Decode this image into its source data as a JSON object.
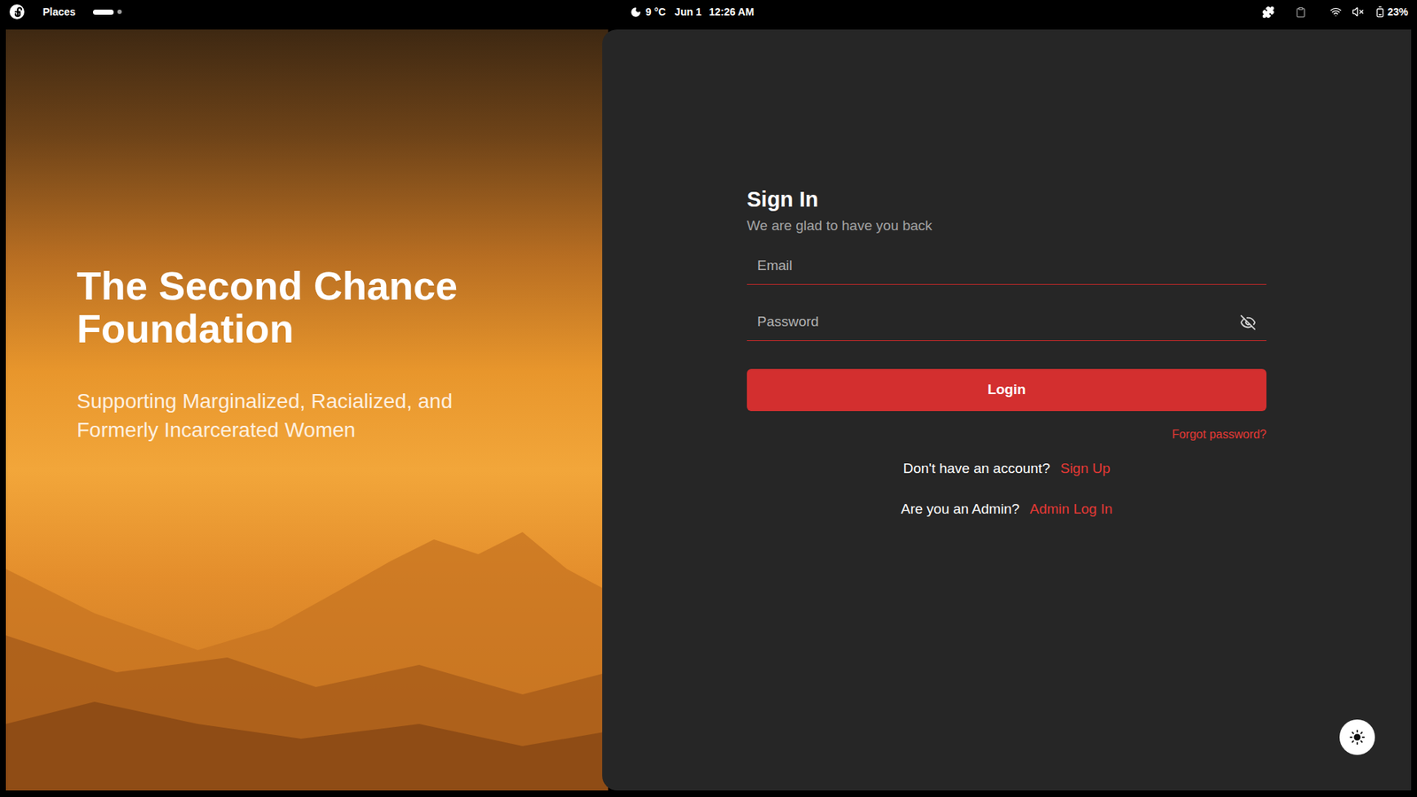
{
  "top_bar": {
    "app_menu": "Places",
    "workspaces": [
      {
        "selected": true
      },
      {
        "selected": false
      }
    ],
    "weather": "9 °C",
    "date": "Jun 1",
    "time": "12:26 AM",
    "battery": "23%",
    "muted": true
  },
  "hero": {
    "title": "The Second Chance Foundation",
    "subtitle": "Supporting Marginalized, Racialized, and Formerly Incarcerated Women"
  },
  "form": {
    "title": "Sign In",
    "subtitle": "We are glad to have you back",
    "fields": [
      {
        "placeholder": "Email",
        "kind": "text",
        "visible": true
      },
      {
        "placeholder": "Password",
        "kind": "password",
        "visible": false
      }
    ],
    "submit": "Login",
    "forgot": "Forgot password?",
    "links": [
      {
        "prompt": "Don't have an account?",
        "link": "Sign Up"
      },
      {
        "prompt": "Are you an Admin?",
        "link": "Admin Log In"
      }
    ]
  },
  "theme_toggle": {
    "dark": true
  }
}
